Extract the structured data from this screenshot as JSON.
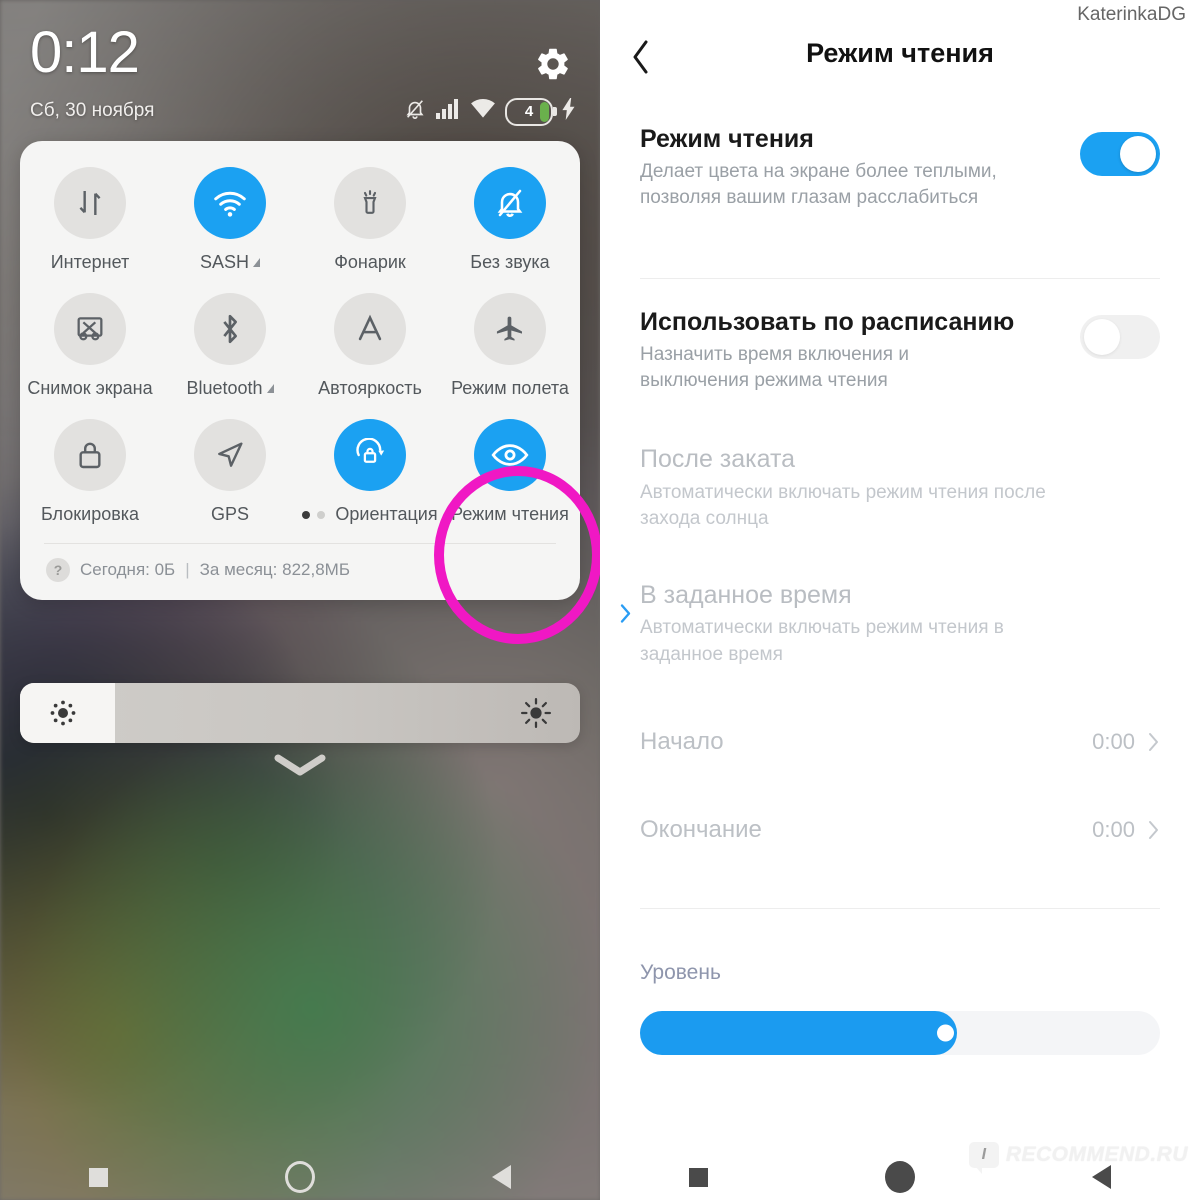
{
  "left_panel": {
    "status_bar": {
      "time": "0:12",
      "date": "Сб, 30 ноября",
      "battery_level": "4",
      "icons": [
        "mute-bell-icon",
        "signal-bars-icon",
        "wifi-icon",
        "battery-icon",
        "charging-bolt-icon"
      ],
      "settings_icon": "gear-icon"
    },
    "quick_settings": {
      "tiles": [
        {
          "label": "Интернет",
          "icon": "data-transfer-icon",
          "active": false
        },
        {
          "label": "SASH",
          "icon": "wifi-icon",
          "active": true,
          "has_caret": true
        },
        {
          "label": "Фонарик",
          "icon": "flashlight-icon",
          "active": false
        },
        {
          "label": "Без звука",
          "icon": "bell-muted-icon",
          "active": true
        },
        {
          "label": "Снимок экрана",
          "icon": "screenshot-icon",
          "active": false
        },
        {
          "label": "Bluetooth",
          "icon": "bluetooth-icon",
          "active": false,
          "has_caret": true
        },
        {
          "label": "Автояркость",
          "icon": "auto-brightness-icon",
          "active": false
        },
        {
          "label": "Режим полета",
          "icon": "airplane-icon",
          "active": false
        },
        {
          "label": "Блокировка",
          "icon": "lock-icon",
          "active": false
        },
        {
          "label": "GPS",
          "icon": "location-arrow-icon",
          "active": false
        },
        {
          "label": "Ориентация",
          "icon": "rotation-lock-icon",
          "active": true,
          "has_dots": true
        },
        {
          "label": "Режим чтения",
          "icon": "eye-icon",
          "active": true,
          "highlighted": true
        }
      ],
      "data_usage": {
        "help_icon": "question-mark-icon",
        "today_label": "Сегодня: 0Б",
        "divider": "|",
        "month_label": "За месяц: 822,8МБ"
      }
    },
    "brightness_slider": {
      "left_icon": "brightness-low-icon",
      "right_icon": "brightness-high-icon",
      "fill_percent": 17
    },
    "collapse_handle_icon": "chevron-down-icon",
    "nav_bar": [
      "recents-square-icon",
      "home-circle-icon",
      "back-triangle-icon"
    ],
    "highlight_color": "#f018c4"
  },
  "right_panel": {
    "watermark_top": "KaterinkaDG",
    "header": {
      "back_icon": "chevron-left-icon",
      "title": "Режим чтения"
    },
    "settings": [
      {
        "title": "Режим чтения",
        "subtitle": "Делает цвета на экране более теплыми,\nпозволяя вашим глазам расслабиться",
        "toggle": "on"
      },
      {
        "title": "Использовать по расписанию",
        "subtitle": "Назначить время включения и\nвыключения режима чтения",
        "toggle": "off"
      },
      {
        "title": "После заката",
        "subtitle": "Автоматически включать режим чтения после\nзахода солнца",
        "disabled": true
      },
      {
        "title": "В заданное время",
        "subtitle": "Автоматически включать режим чтения в\nзаданное время",
        "disabled": true,
        "selected_icon": "chevron-right-icon"
      }
    ],
    "time_rows": [
      {
        "label": "Начало",
        "value": "0:00",
        "chevron": "chevron-right-icon"
      },
      {
        "label": "Окончание",
        "value": "0:00",
        "chevron": "chevron-right-icon"
      }
    ],
    "level": {
      "label": "Уровень",
      "fill_percent": 61
    },
    "nav_bar": [
      "recents-square-icon",
      "home-circle-icon",
      "back-triangle-icon"
    ],
    "watermark_bottom": {
      "badge": "I",
      "text": "RECOMMEND.RU"
    },
    "accent_color": "#1ba1f2"
  }
}
